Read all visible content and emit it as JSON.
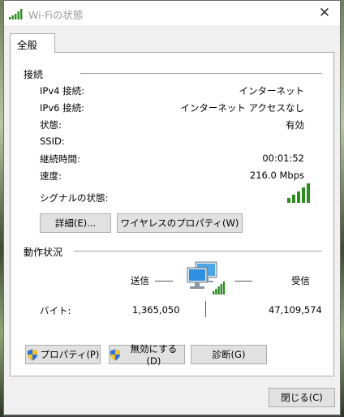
{
  "window": {
    "title": "Wi-Fiの状態",
    "close_glyph": "✕"
  },
  "tabs": [
    {
      "label": "全般"
    }
  ],
  "connection": {
    "section_label": "接続",
    "rows": [
      {
        "label": "IPv4 接続:",
        "value": "インターネット"
      },
      {
        "label": "IPv6 接続:",
        "value": "インターネット アクセスなし"
      },
      {
        "label": "状態:",
        "value": "有効"
      },
      {
        "label": "SSID:",
        "value": ""
      },
      {
        "label": "継続時間:",
        "value": "00:01:52"
      },
      {
        "label": "速度:",
        "value": "216.0 Mbps"
      }
    ],
    "signal_label": "シグナルの状態:",
    "signal_bars": 5,
    "details_button": "詳細(E)...",
    "wireless_props_button": "ワイヤレスのプロパティ(W)"
  },
  "activity": {
    "section_label": "動作状況",
    "sent_label": "送信",
    "received_label": "受信",
    "bytes_label": "バイト:",
    "bytes_sent": "1,365,050",
    "bytes_received": "47,109,574"
  },
  "actions": {
    "properties_button": "プロパティ(P)",
    "disable_button": "無効にする(D)",
    "diagnose_button": "診断(G)"
  },
  "footer": {
    "close_button": "閉じる(C)"
  },
  "colors": {
    "signal_green": "#2e8b21",
    "window_bg": "#f0f0f0",
    "panel_bg": "#ffffff",
    "button_bg": "#e1e1e1"
  }
}
